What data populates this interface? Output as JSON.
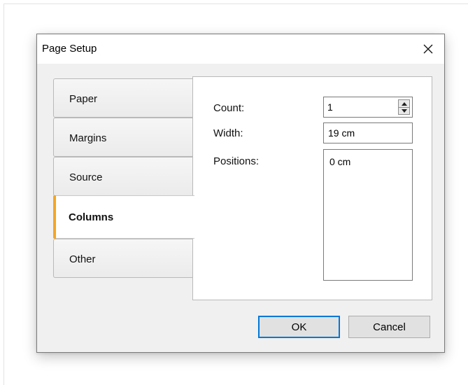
{
  "dialog": {
    "title": "Page Setup",
    "close_icon": "close-icon"
  },
  "tabs": [
    {
      "label": "Paper",
      "active": false
    },
    {
      "label": "Margins",
      "active": false
    },
    {
      "label": "Source",
      "active": false
    },
    {
      "label": "Columns",
      "active": true
    },
    {
      "label": "Other",
      "active": false
    }
  ],
  "columns": {
    "count_label": "Count:",
    "count_value": "1",
    "width_label": "Width:",
    "width_value": "19 cm",
    "positions_label": "Positions:",
    "positions_items": [
      "0 cm"
    ]
  },
  "buttons": {
    "ok_label": "OK",
    "cancel_label": "Cancel"
  },
  "colors": {
    "accent": "#f5a623",
    "focus": "#0078d7"
  }
}
